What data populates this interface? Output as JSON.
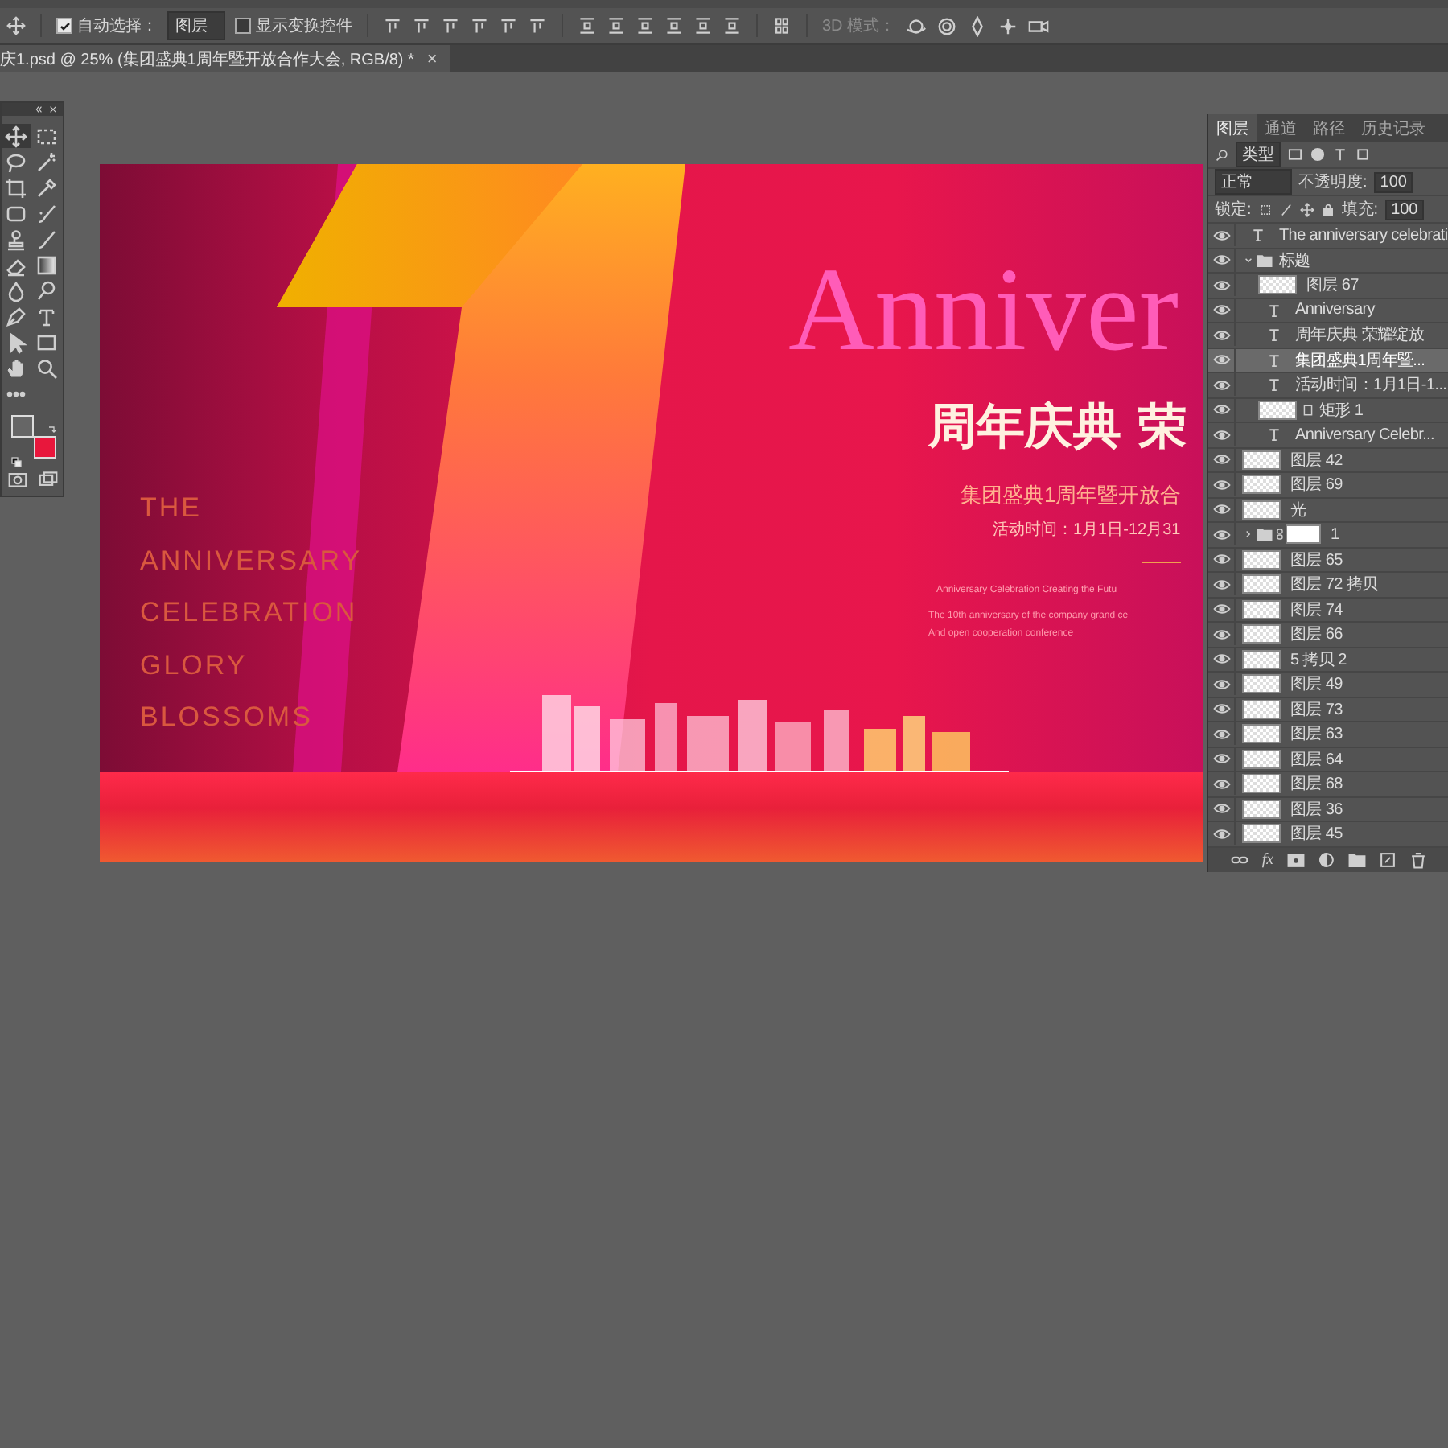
{
  "options_bar": {
    "auto_select": {
      "label": "自动选择：",
      "checked": true
    },
    "target": "图层",
    "transform_controls": {
      "label": "显示变换控件",
      "checked": false
    },
    "mode_3d_label": "3D 模式："
  },
  "document_tab": {
    "title": "庆1.psd @ 25% (集团盛典1周年暨开放合作大会, RGB/8) *",
    "close": "×"
  },
  "toolbox": {
    "tools": [
      {
        "kind": "move",
        "selected": true
      },
      {
        "kind": "marquee",
        "selected": false
      },
      {
        "kind": "lasso",
        "selected": false
      },
      {
        "kind": "wand",
        "selected": false
      },
      {
        "kind": "crop",
        "selected": false
      },
      {
        "kind": "eyedropper",
        "selected": false
      },
      {
        "kind": "frame",
        "selected": false
      },
      {
        "kind": "healing",
        "selected": false
      },
      {
        "kind": "stamp",
        "selected": false
      },
      {
        "kind": "brush",
        "selected": false
      },
      {
        "kind": "eraser",
        "selected": false
      },
      {
        "kind": "gradient",
        "selected": false
      },
      {
        "kind": "blur",
        "selected": false
      },
      {
        "kind": "dodge",
        "selected": false
      },
      {
        "kind": "pen",
        "selected": false
      },
      {
        "kind": "type",
        "selected": false
      },
      {
        "kind": "path_select",
        "selected": false
      },
      {
        "kind": "rectangle",
        "selected": false
      },
      {
        "kind": "hand",
        "selected": false
      },
      {
        "kind": "zoom",
        "selected": false
      },
      {
        "kind": "more",
        "selected": false
      }
    ],
    "swatches": [
      {
        "color": "#666666"
      },
      {
        "color": "#e8173c"
      }
    ]
  },
  "artwork": {
    "side_lines": [
      "THE",
      "ANNIVERSARY",
      "CELEBRATION",
      "GLORY",
      "BLOSSOMS"
    ],
    "big_word": "Anniver",
    "headline": "周年庆典 荣",
    "subtitle": "集团盛典1周年暨开放合",
    "date": "活动时间：1月1日-12月31",
    "tagline": "Anniversary Celebration Creating the Futu",
    "description": [
      "The 10th anniversary of the company grand ce",
      "And open cooperation conference"
    ]
  },
  "layers_panel": {
    "tabs": [
      {
        "label": "图层",
        "selected": true
      },
      {
        "label": "通道",
        "selected": false
      },
      {
        "label": "路径",
        "selected": false
      },
      {
        "label": "历史记录",
        "selected": false
      }
    ],
    "filter": "类型",
    "blend_mode": "正常",
    "opacity_label": "不透明度:",
    "opacity": "100",
    "lock_label": "锁定:",
    "fill_label": "填充:",
    "fill": "100",
    "style_button": "fx",
    "layers": [
      {
        "name": "The anniversary celebrati",
        "kind": "text",
        "visible": true,
        "selected": false
      },
      {
        "name": "标题",
        "kind": "group",
        "visible": true,
        "selected": false,
        "expanded": true,
        "mask": false,
        "children": [
          {
            "name": "图层 67",
            "kind": "image",
            "visible": true,
            "selected": false
          },
          {
            "name": "Anniversary",
            "kind": "text",
            "visible": true,
            "selected": false
          },
          {
            "name": "周年庆典 荣耀绽放",
            "kind": "text",
            "visible": true,
            "selected": false
          },
          {
            "name": "集团盛典1周年暨...",
            "kind": "text",
            "visible": true,
            "selected": true
          },
          {
            "name": "活动时间：1月1日-1...",
            "kind": "text",
            "visible": true,
            "selected": false
          },
          {
            "name": "矩形 1",
            "kind": "shape",
            "visible": true,
            "selected": false
          },
          {
            "name": "Anniversary Celebr...",
            "kind": "text",
            "visible": true,
            "selected": false
          }
        ]
      },
      {
        "name": "图层 42",
        "kind": "image",
        "visible": true,
        "selected": false
      },
      {
        "name": "图层 69",
        "kind": "image",
        "visible": true,
        "selected": false
      },
      {
        "name": "光",
        "kind": "image",
        "visible": true,
        "selected": false
      },
      {
        "name": "1",
        "kind": "group",
        "visible": true,
        "selected": false,
        "expanded": false,
        "mask": true
      },
      {
        "name": "图层 65",
        "kind": "image",
        "visible": true,
        "selected": false
      },
      {
        "name": "图层 72 拷贝",
        "kind": "image",
        "visible": true,
        "selected": false
      },
      {
        "name": "图层 74",
        "kind": "image",
        "visible": true,
        "selected": false
      },
      {
        "name": "图层 66",
        "kind": "image",
        "visible": true,
        "selected": false
      },
      {
        "name": "5 拷贝 2",
        "kind": "image",
        "visible": true,
        "selected": false
      },
      {
        "name": "图层 49",
        "kind": "image",
        "visible": true,
        "selected": false
      },
      {
        "name": "图层 73",
        "kind": "image",
        "visible": true,
        "selected": false
      },
      {
        "name": "图层 63",
        "kind": "image",
        "visible": true,
        "selected": false
      },
      {
        "name": "图层 64",
        "kind": "image",
        "visible": true,
        "selected": false
      },
      {
        "name": "图层 68",
        "kind": "image",
        "visible": true,
        "selected": false
      },
      {
        "name": "图层 36",
        "kind": "image",
        "visible": true,
        "selected": false
      },
      {
        "name": "图层 45",
        "kind": "image",
        "visible": true,
        "selected": false
      }
    ]
  }
}
